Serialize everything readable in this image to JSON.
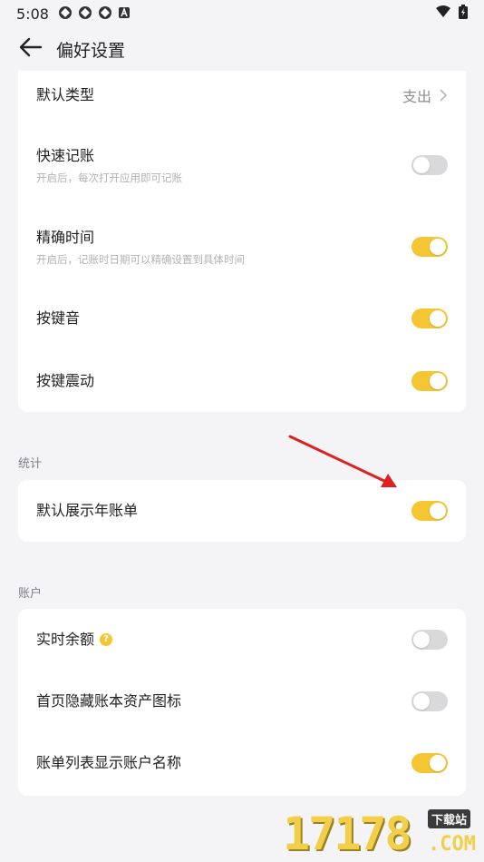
{
  "status_bar": {
    "time": "5:08",
    "left_icons": [
      "app-icon-1",
      "app-icon-2",
      "app-icon-3",
      "a-icon"
    ],
    "right_icons": [
      "wifi-icon",
      "battery-icon"
    ]
  },
  "app_bar": {
    "title": "偏好设置"
  },
  "colors": {
    "accent": "#f5c634",
    "toggle_off": "#d9d9dc",
    "arrow": "#e02020"
  },
  "general": {
    "default_type": {
      "label": "默认类型",
      "value": "支出"
    },
    "quick_record": {
      "label": "快速记账",
      "sub": "开启后，每次打开应用即可记账",
      "on": false
    },
    "precise_time": {
      "label": "精确时间",
      "sub": "开启后，记账时日期可以精确设置到具体时间",
      "on": true
    },
    "key_sound": {
      "label": "按键音",
      "on": true
    },
    "key_vibrate": {
      "label": "按键震动",
      "on": true
    }
  },
  "stats": {
    "section_label": "统计",
    "show_year_bill": {
      "label": "默认展示年账单",
      "on": true
    }
  },
  "account": {
    "section_label": "账户",
    "realtime_balance": {
      "label": "实时余额",
      "help": "?",
      "on": false
    },
    "hide_asset_icon": {
      "label": "首页隐藏账本资产图标",
      "on": false
    },
    "show_account_name": {
      "label": "账单列表显示账户名称",
      "on": true
    }
  },
  "watermark": {
    "number": "17178",
    "badge": "下载站",
    "com": ".COM"
  }
}
